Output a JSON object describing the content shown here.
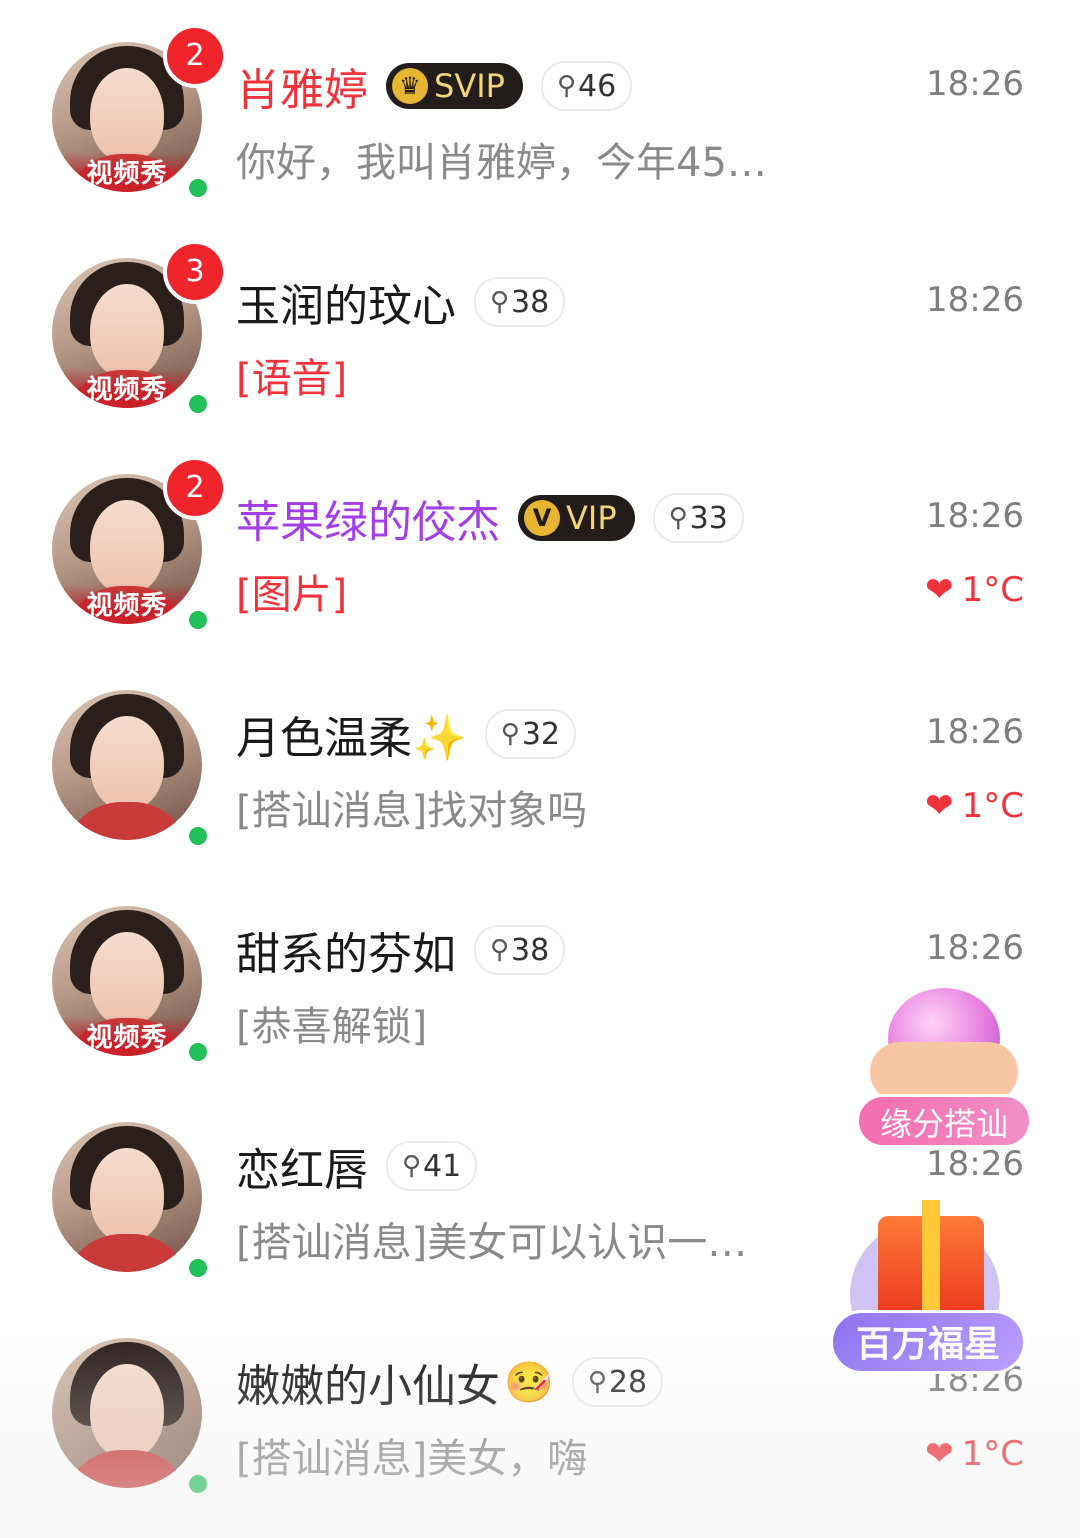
{
  "conversations": [
    {
      "name": "肖雅婷",
      "name_color": "red",
      "vip": "SVIP",
      "vip_icon": "crown-icon",
      "level": "46",
      "time": "18:26",
      "message": "你好，我叫肖雅婷，今年45…",
      "message_color": "gray",
      "unread": "2",
      "video_tag": "视频秀",
      "temp": "",
      "online": true
    },
    {
      "name": "玉润的玟心",
      "name_color": "default",
      "vip": "",
      "level": "38",
      "time": "18:26",
      "message": "[语音]",
      "message_color": "red",
      "unread": "3",
      "video_tag": "视频秀",
      "temp": "",
      "online": true
    },
    {
      "name": "苹果绿的佼杰",
      "name_color": "purple",
      "vip": "VIP",
      "vip_icon": "v-icon",
      "level": "33",
      "time": "18:26",
      "message": "[图片]",
      "message_color": "red",
      "unread": "2",
      "video_tag": "视频秀",
      "temp": "1°C",
      "online": true
    },
    {
      "name": "月色温柔✨",
      "name_color": "default",
      "vip": "",
      "level": "32",
      "time": "18:26",
      "message": "[搭讪消息]找对象吗",
      "message_color": "gray",
      "unread": "",
      "video_tag": "",
      "temp": "1°C",
      "online": true
    },
    {
      "name": "甜系的芬如",
      "name_color": "default",
      "vip": "",
      "level": "38",
      "time": "18:26",
      "message": "[恭喜解锁]",
      "message_color": "gray",
      "unread": "",
      "video_tag": "视频秀",
      "temp": "",
      "online": true
    },
    {
      "name": "恋红唇",
      "name_color": "default",
      "vip": "",
      "level": "41",
      "time": "18:26",
      "message": "[搭讪消息]美女可以认识一…",
      "message_color": "gray",
      "unread": "",
      "video_tag": "",
      "temp": "",
      "online": true
    },
    {
      "name": "嫩嫩的小仙女",
      "name_emoji": "🤒",
      "name_color": "default",
      "vip": "",
      "level": "28",
      "time": "18:26",
      "message": "[搭讪消息]美女，嗨",
      "message_color": "gray",
      "unread": "",
      "video_tag": "",
      "temp": "1°C",
      "online": true
    }
  ],
  "floating": {
    "match_label": "缘分搭讪",
    "gift_label": "百万福星"
  },
  "icons": {
    "heart": "heart-icon",
    "level": "female-symbol-icon",
    "online": "online-dot-icon"
  },
  "colors": {
    "red": "#f0333a",
    "purple": "#a43ee6",
    "online": "#20c05a",
    "badge": "#f0242b"
  }
}
